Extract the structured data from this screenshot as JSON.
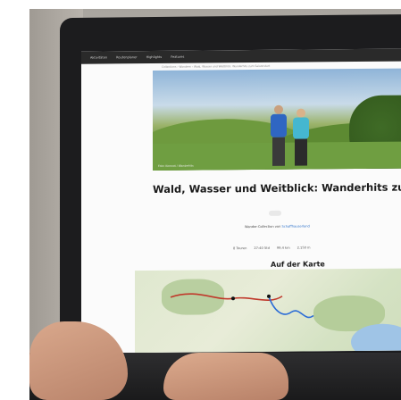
{
  "nav": {
    "items": [
      "Aktivitäten",
      "Routenplaner",
      "Highlights",
      "Features"
    ]
  },
  "breadcrumb": "Collections › Wandern › Wald, Wasser und Weitblick: Wanderhits zum Saisonstart",
  "hero": {
    "caption": "Foto: Komoot / Wanderhits"
  },
  "article": {
    "title": "Wald, Wasser und Weitblick: Wanderhits zum Saisonstart",
    "byline_prefix": "Wander-Collection von",
    "byline_author": "Schaffhauserland"
  },
  "stats": [
    "8 Touren",
    "27:40 Std",
    "99,4 km",
    "2.150 m"
  ],
  "map_section": {
    "title": "Auf der Karte"
  },
  "colors": {
    "link": "#2b70c9",
    "nav_bg": "#2a2a2a"
  }
}
